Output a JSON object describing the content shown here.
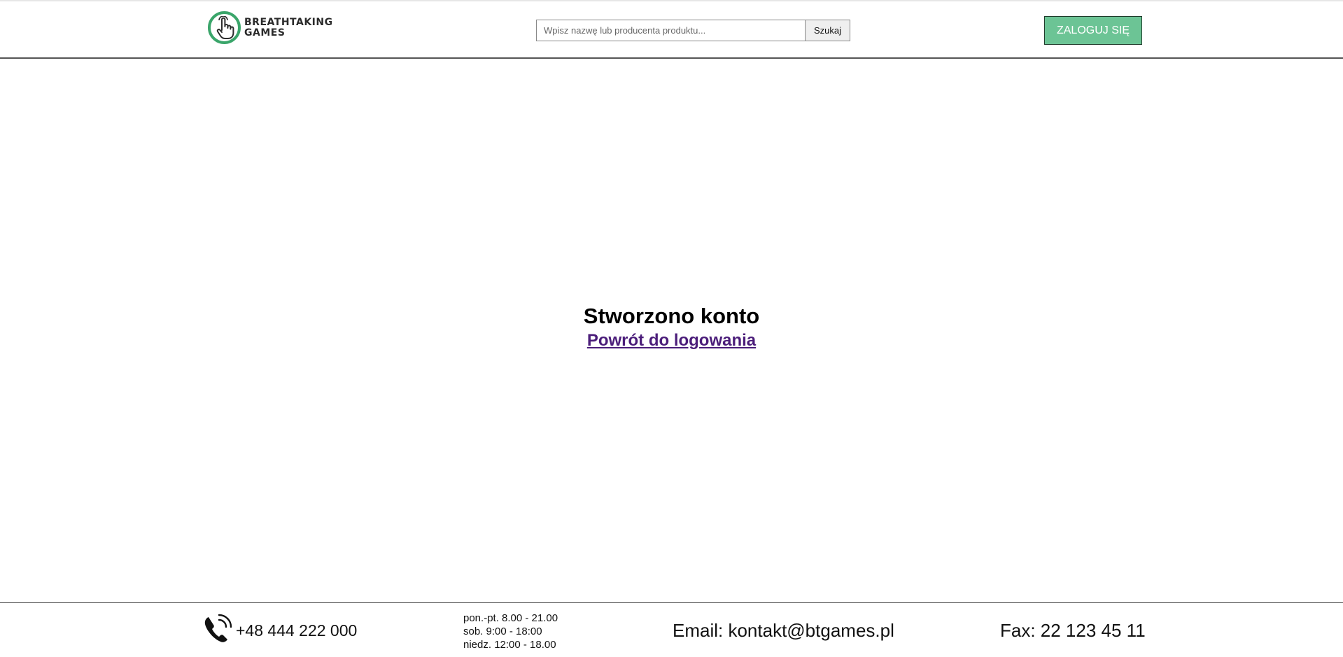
{
  "header": {
    "logo_line1": "BREATHTAKING",
    "logo_line2": "GAMES",
    "search_placeholder": "Wpisz nazwę lub producenta produktu...",
    "search_button": "Szukaj",
    "login_button": "ZALOGUJ SIĘ"
  },
  "main": {
    "title": "Stworzono konto",
    "link": "Powrót do logowania"
  },
  "footer": {
    "phone": "+48 444 222 000",
    "hours": [
      "pon.-pt. 8.00 - 21.00",
      "sob. 9:00 - 18:00",
      "niedz. 12:00 - 18.00"
    ],
    "email": "Email: kontakt@btgames.pl",
    "fax": "Fax: 22 123 45 11"
  },
  "colors": {
    "brand_green": "#3aa56a",
    "login_button_bg": "#6cc495",
    "link_color": "#4b1d7a"
  },
  "icons": {
    "logo": "pointing-hand-icon",
    "phone": "phone-ringing-icon"
  }
}
